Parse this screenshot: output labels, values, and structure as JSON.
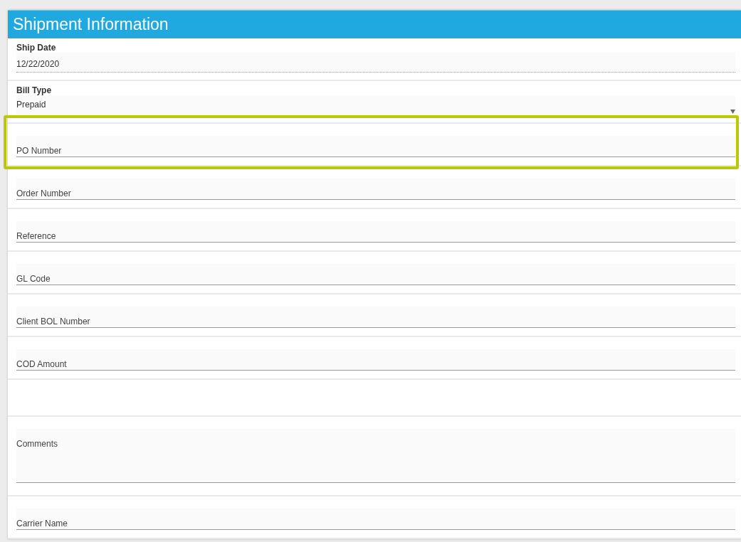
{
  "panel": {
    "title": "Shipment Information"
  },
  "fields": [
    {
      "kind": "date",
      "label": "Ship Date",
      "value": "12/22/2020",
      "highlighted": false
    },
    {
      "kind": "select",
      "label": "Bill Type",
      "value": "Prepaid",
      "highlighted": false
    },
    {
      "kind": "text",
      "placeholder": "PO Number",
      "highlighted": true
    },
    {
      "kind": "text",
      "placeholder": "Order Number",
      "highlighted": false
    },
    {
      "kind": "text",
      "placeholder": "Reference",
      "highlighted": false
    },
    {
      "kind": "text",
      "placeholder": "GL Code",
      "highlighted": false
    },
    {
      "kind": "text",
      "placeholder": "Client BOL Number",
      "highlighted": false
    },
    {
      "kind": "text",
      "placeholder": "COD Amount",
      "highlighted": false
    },
    {
      "kind": "spacer",
      "highlighted": false
    },
    {
      "kind": "textarea",
      "placeholder": "Comments",
      "highlighted": false
    },
    {
      "kind": "text",
      "placeholder": "Carrier Name",
      "highlighted": false
    }
  ]
}
